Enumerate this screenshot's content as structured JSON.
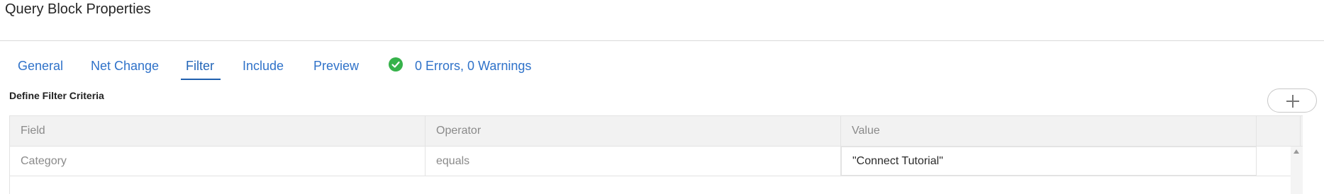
{
  "window": {
    "title": "Query Block Properties"
  },
  "tabs": [
    {
      "label": "General",
      "active": false
    },
    {
      "label": "Net Change",
      "active": false
    },
    {
      "label": "Filter",
      "active": true
    },
    {
      "label": "Include",
      "active": false
    },
    {
      "label": "Preview",
      "active": false
    }
  ],
  "status": {
    "icon": "check-circle-icon",
    "text": "0 Errors, 0 Warnings",
    "color": "#36b24a"
  },
  "section": {
    "title": "Define Filter Criteria",
    "add_icon": "plus-icon"
  },
  "table": {
    "columns": [
      "Field",
      "Operator",
      "Value",
      ""
    ],
    "rows": [
      {
        "field": "Category",
        "operator": "equals",
        "value": "\"Connect Tutorial\""
      }
    ]
  },
  "colors": {
    "tab_text": "#2f72c9",
    "active_underline": "#1f5fae",
    "grid_header_bg": "#f2f2f2"
  }
}
